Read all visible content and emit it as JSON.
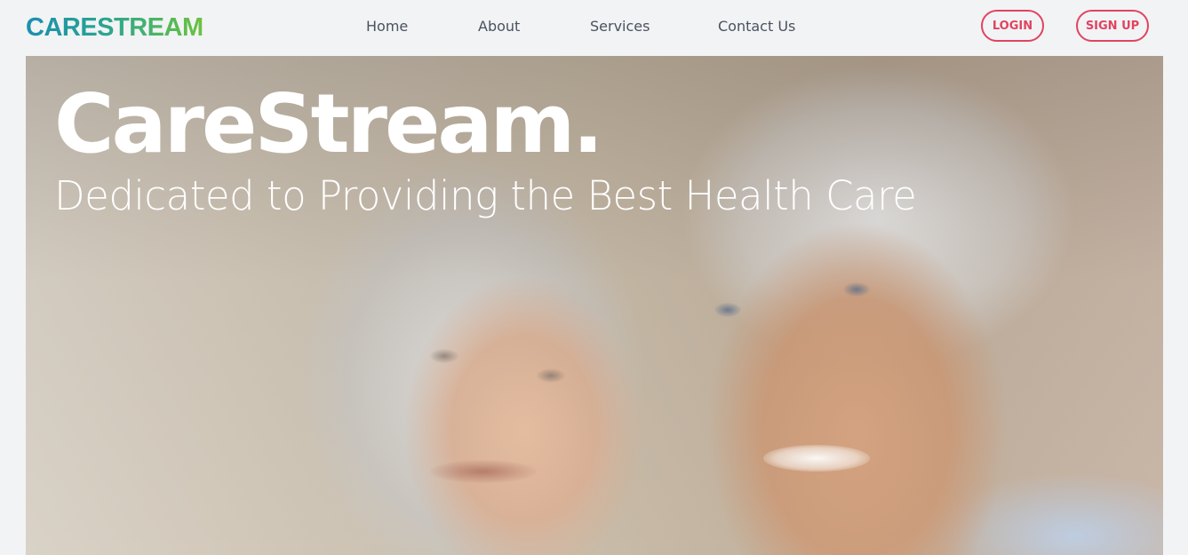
{
  "navbar": {
    "logo": "CARESTREAM",
    "links": [
      {
        "label": "Home"
      },
      {
        "label": "About"
      },
      {
        "label": "Services"
      },
      {
        "label": "Contact Us"
      }
    ],
    "login_label": "LOGIN",
    "signup_label": "SIGN UP"
  },
  "hero": {
    "title": "CareStream.",
    "subtitle": "Dedicated to Providing the Best Health Care",
    "image": "photo of smiling elderly couple"
  },
  "colors": {
    "background": "#f2f3f5",
    "accent": "#e0445f",
    "logo_gradient_start": "#1a8fb0",
    "logo_gradient_end": "#6cc23d",
    "nav_text": "#4a5260",
    "hero_text": "#ffffff"
  }
}
